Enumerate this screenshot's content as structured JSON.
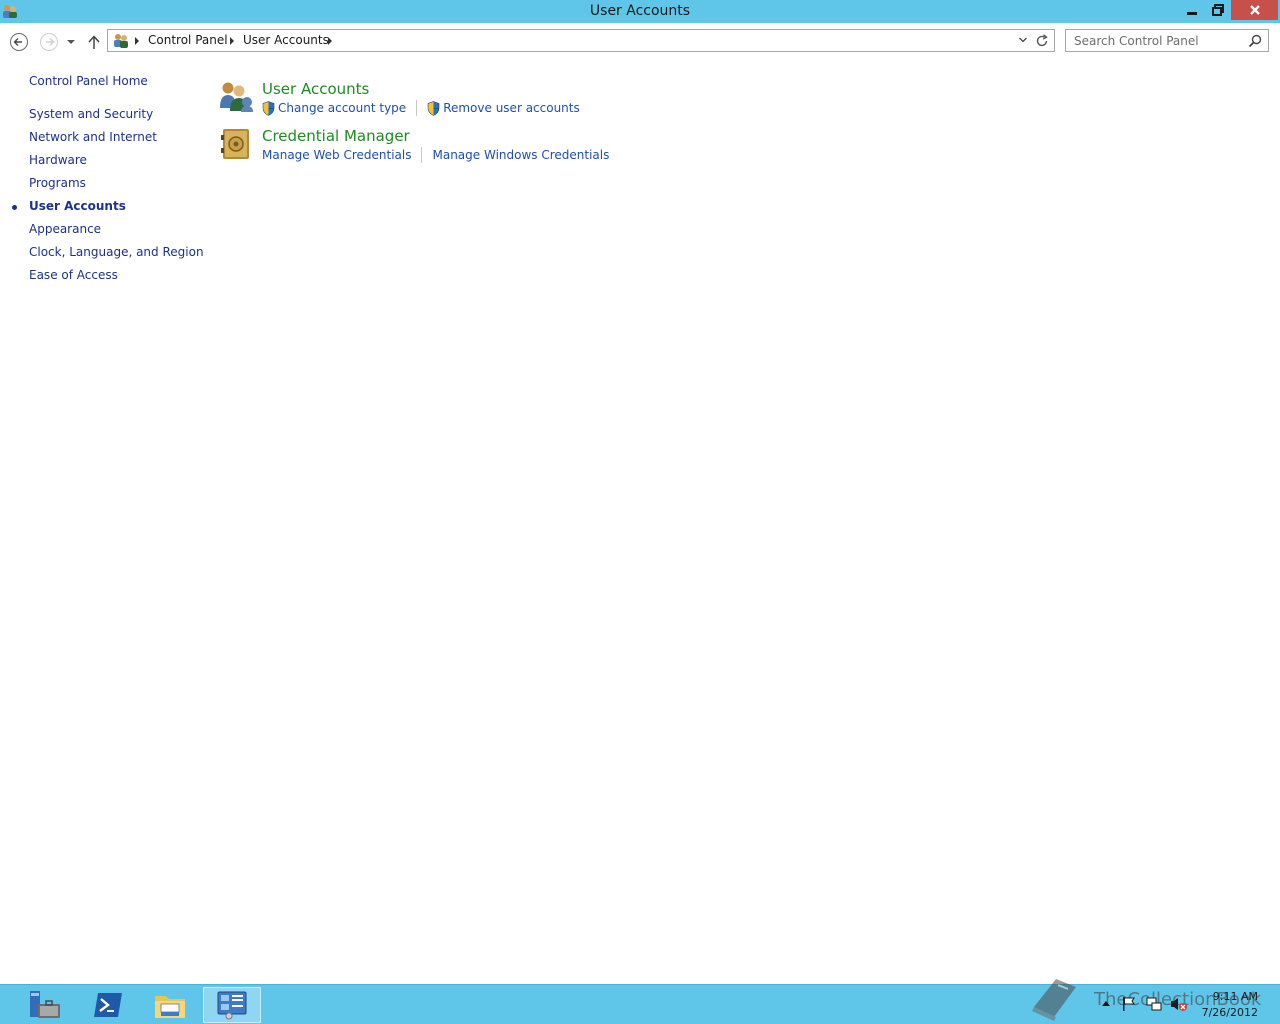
{
  "window": {
    "title": "User Accounts",
    "controls": {
      "minimize": "minimize",
      "maximize": "restore",
      "close": "close"
    }
  },
  "nav": {
    "breadcrumbs": [
      "Control Panel",
      "User Accounts"
    ],
    "search_placeholder": "Search Control Panel"
  },
  "sidebar": {
    "items": [
      {
        "label": "Control Panel Home",
        "current": false
      },
      {
        "label": "System and Security",
        "current": false
      },
      {
        "label": "Network and Internet",
        "current": false
      },
      {
        "label": "Hardware",
        "current": false
      },
      {
        "label": "Programs",
        "current": false
      },
      {
        "label": "User Accounts",
        "current": true
      },
      {
        "label": "Appearance",
        "current": false
      },
      {
        "label": "Clock, Language, and Region",
        "current": false
      },
      {
        "label": "Ease of Access",
        "current": false
      }
    ]
  },
  "main": {
    "categories": [
      {
        "title": "User Accounts",
        "icon": "users-icon",
        "links": [
          {
            "label": "Change account type",
            "shield": true
          },
          {
            "label": "Remove user accounts",
            "shield": true
          }
        ]
      },
      {
        "title": "Credential Manager",
        "icon": "vault-icon",
        "links": [
          {
            "label": "Manage Web Credentials",
            "shield": false
          },
          {
            "label": "Manage Windows Credentials",
            "shield": false
          }
        ]
      }
    ]
  },
  "taskbar": {
    "apps": [
      "server-manager-icon",
      "powershell-icon",
      "file-explorer-icon",
      "control-panel-icon"
    ],
    "active_app": "control-panel-icon",
    "time": "9:11 AM",
    "date": "7/26/2012",
    "watermark": "TheCollectionBook"
  },
  "colors": {
    "titlebar": "#5fc6ea",
    "close_button": "#c7504a",
    "link_blue": "#1e4fb0",
    "category_green": "#1f8b22",
    "nav_blue": "#1e3287"
  }
}
